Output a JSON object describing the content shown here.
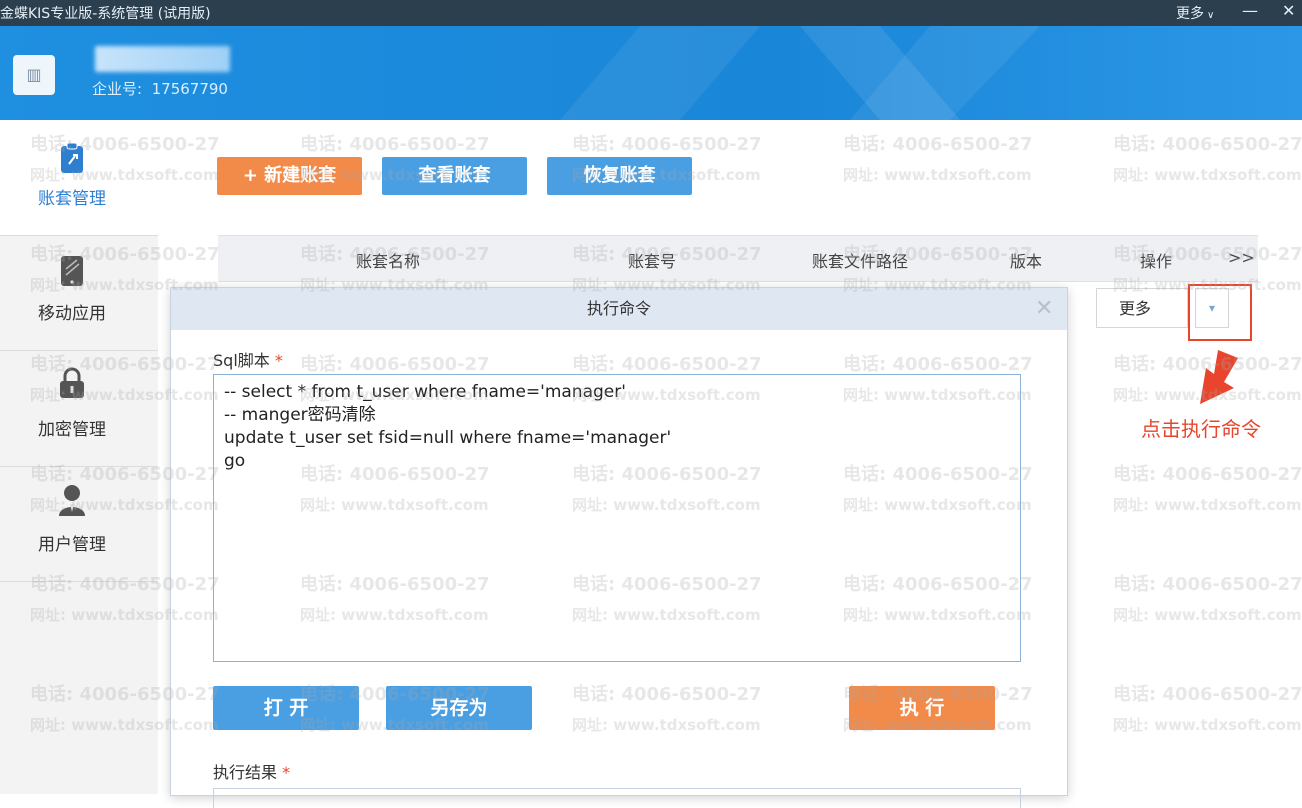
{
  "titlebar": {
    "title": "金蝶KIS专业版-系统管理 (试用版)",
    "more": "更多",
    "minimize": "—",
    "close": "✕"
  },
  "header": {
    "enterprise_label": "企业号:",
    "enterprise_no": "17567790"
  },
  "sidebar": {
    "items": [
      {
        "label": "账套管理",
        "icon": "clipboard-icon"
      },
      {
        "label": "移动应用",
        "icon": "mobile-icon"
      },
      {
        "label": "加密管理",
        "icon": "lock-icon"
      },
      {
        "label": "用户管理",
        "icon": "user-icon"
      }
    ]
  },
  "toolbar": {
    "new_label": "+ 新建账套",
    "view_label": "查看账套",
    "restore_label": "恢复账套"
  },
  "table": {
    "columns": [
      "账套名称",
      "账套号",
      "账套文件路径",
      "版本",
      "操作",
      ">>"
    ],
    "row_more": "更多"
  },
  "annotation": "点击执行命令",
  "dialog": {
    "title": "执行命令",
    "close": "✕",
    "sql_label": "Sql脚本",
    "required": "*",
    "sql_lines": [
      "-- select * from t_user where fname='manager'",
      "-- manger密码清除",
      "update t_user set fsid=null where fname='manager'",
      "go"
    ],
    "open_label": "打 开",
    "saveas_label": "另存为",
    "exec_label": "执 行",
    "result_label": "执行结果"
  },
  "watermark": {
    "phone": "电话: 4006-6500-27",
    "site": "网址: www.tdxsoft.com"
  },
  "colors": {
    "titlebar": "#2b3f4f",
    "header_blue": "#1f8fe0",
    "button_blue": "#4a9fe3",
    "button_orange": "#f28a4a",
    "dialog_head": "#dfe7f3",
    "annotation_red": "#e8452c"
  }
}
